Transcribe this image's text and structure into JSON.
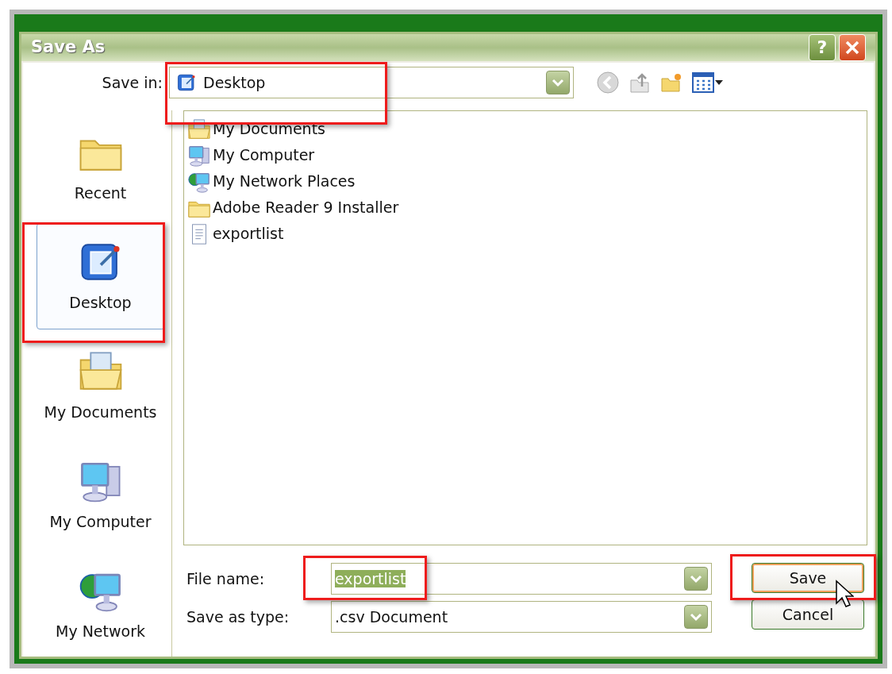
{
  "window": {
    "title": "Save As",
    "buttons": [
      {
        "kind": "help",
        "label": "?"
      }
    ]
  },
  "save_in": {
    "label": "Save in:",
    "value": "Desktop"
  },
  "places": [
    {
      "label": "Recent",
      "kind": "recent",
      "selected": false
    },
    {
      "label": "Desktop",
      "kind": "desktop",
      "selected": true
    },
    {
      "label": "My Documents",
      "kind": "documents",
      "selected": false
    },
    {
      "label": "My Computer",
      "kind": "computer",
      "selected": false
    },
    {
      "label": "My Network",
      "kind": "network",
      "selected": false
    }
  ],
  "files": [
    {
      "name": "My Documents",
      "kind": "documents"
    },
    {
      "name": "My Computer",
      "kind": "computer"
    },
    {
      "name": "My Network Places",
      "kind": "network"
    },
    {
      "name": "Adobe Reader 9 Installer",
      "kind": "folder"
    },
    {
      "name": "exportlist",
      "kind": "file"
    }
  ],
  "file_name": {
    "label": "File name:",
    "value": "exportlist"
  },
  "save_as_type": {
    "label": "Save as type:",
    "value": ".csv Document"
  },
  "buttons": [
    {
      "label": "Save",
      "default": true
    },
    {
      "label": "Cancel",
      "default": false
    }
  ]
}
